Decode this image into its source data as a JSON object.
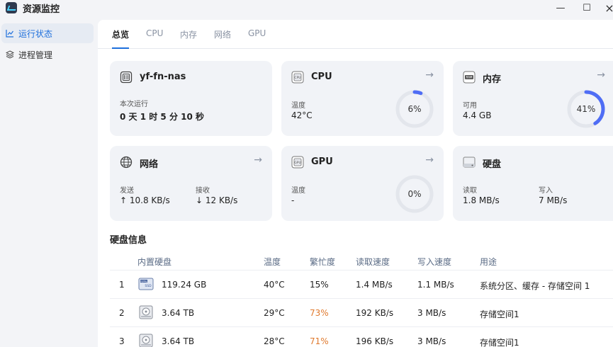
{
  "window": {
    "title": "资源监控",
    "minimize": "—",
    "maximize": "☐",
    "close": "×"
  },
  "sidebar": {
    "items": [
      {
        "label": "运行状态",
        "active": true
      },
      {
        "label": "进程管理",
        "active": false
      }
    ]
  },
  "tabs": [
    "总览",
    "CPU",
    "内存",
    "网络",
    "GPU"
  ],
  "cards": {
    "host": {
      "name": "yf-fn-nas",
      "uptime_label": "本次运行",
      "uptime_value": "0 天 1 时 5 分 10 秒"
    },
    "cpu": {
      "title": "CPU",
      "temp_label": "温度",
      "temp_value": "42°C",
      "usage_text": "6%",
      "usage_fraction": 0.06
    },
    "memory": {
      "title": "内存",
      "avail_label": "可用",
      "avail_value": "4.4 GB",
      "usage_text": "41%",
      "usage_fraction": 0.41
    },
    "network": {
      "title": "网络",
      "send_label": "发送",
      "send_value": "↑ 10.8 KB/s",
      "recv_label": "接收",
      "recv_value": "↓ 12 KB/s"
    },
    "gpu": {
      "title": "GPU",
      "temp_label": "温度",
      "temp_value": "-",
      "usage_text": "0%",
      "usage_fraction": 0
    },
    "disk": {
      "title": "硬盘",
      "read_label": "读取",
      "read_value": "1.8 MB/s",
      "write_label": "写入",
      "write_value": "7 MB/s"
    }
  },
  "disk_info": {
    "title": "硬盘信息",
    "columns": [
      "内置硬盘",
      "温度",
      "繁忙度",
      "读取速度",
      "写入速度",
      "用途"
    ],
    "rows": [
      {
        "index": "1",
        "size": "119.24 GB",
        "temp": "40°C",
        "busy": "15%",
        "read": "1.4 MB/s",
        "write": "1.1 MB/s",
        "usage": "系统分区、缓存 - 存储空间 1",
        "busy_warn": false,
        "icon": "ssd-icon"
      },
      {
        "index": "2",
        "size": "3.64 TB",
        "temp": "29°C",
        "busy": "73%",
        "read": "192 KB/s",
        "write": "3 MB/s",
        "usage": "存储空间1",
        "busy_warn": true,
        "icon": "hdd-icon"
      },
      {
        "index": "3",
        "size": "3.64 TB",
        "temp": "28°C",
        "busy": "71%",
        "read": "196 KB/s",
        "write": "3 MB/s",
        "usage": "存储空间1",
        "busy_warn": true,
        "icon": "hdd-icon"
      }
    ]
  },
  "colors": {
    "accent": "#1d6fdc",
    "ring_fill": "#4f6df5",
    "ring_track": "#e3e6ec",
    "warn": "#e07a2e"
  }
}
